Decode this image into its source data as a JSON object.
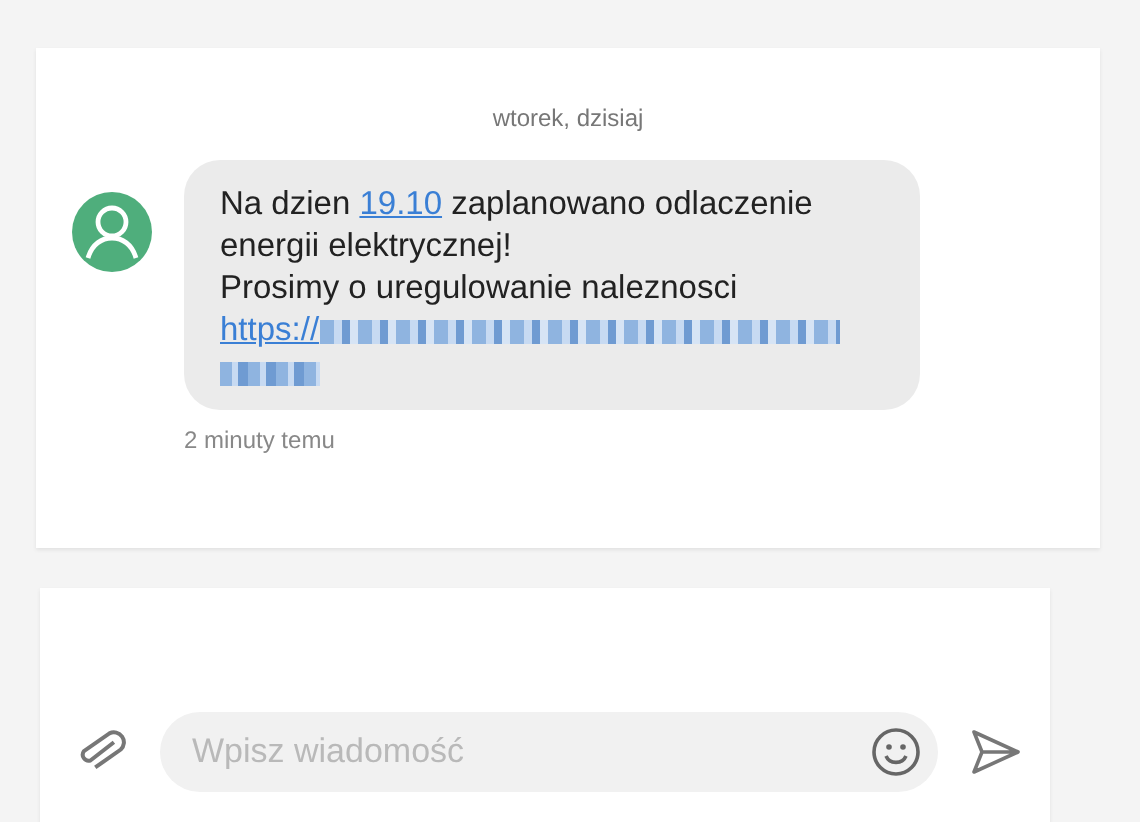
{
  "conversation": {
    "date_header": "wtorek, dzisiaj",
    "message": {
      "before_date": "Na dzien ",
      "date_link": "19.10",
      "after_date": " zaplanowano odlaczenie energii elektrycznej!",
      "second_line": "Prosimy o uregulowanie naleznosci",
      "link": "https://",
      "link_blurred": true
    },
    "timestamp": "2 minuty temu"
  },
  "composer": {
    "placeholder": "Wpisz wiadomość"
  }
}
